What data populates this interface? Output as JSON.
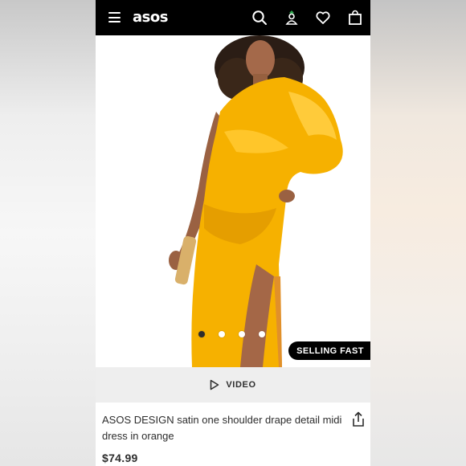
{
  "header": {
    "logo": "asos",
    "icons": [
      "menu-icon",
      "search-icon",
      "account-icon",
      "heart-icon",
      "bag-icon"
    ]
  },
  "gallery": {
    "image_count": 4,
    "active_index": 0,
    "badge": "SELLING FAST"
  },
  "video": {
    "label": "VIDEO"
  },
  "product": {
    "title": "ASOS DESIGN satin one shoulder drape detail midi dress in orange",
    "price": "$74.99"
  },
  "colors": {
    "header_bg": "#000000",
    "dress": "#f6b100",
    "text": "#2d2d2d"
  }
}
